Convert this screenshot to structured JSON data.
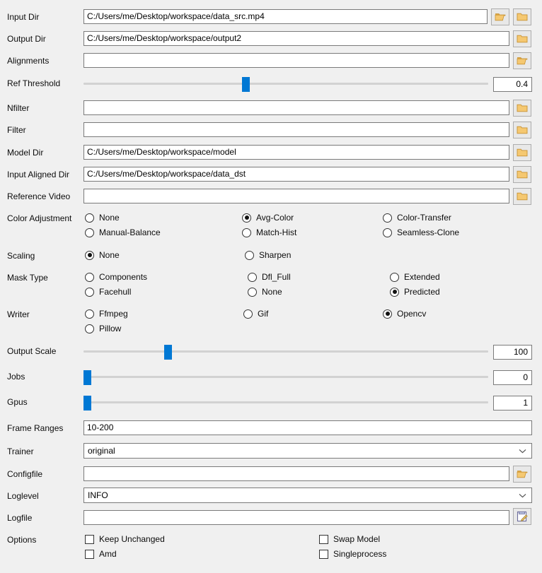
{
  "fields": {
    "input_dir": {
      "label": "Input Dir",
      "value": "C:/Users/me/Desktop/workspace/data_src.mp4"
    },
    "output_dir": {
      "label": "Output Dir",
      "value": "C:/Users/me/Desktop/workspace/output2"
    },
    "alignments": {
      "label": "Alignments",
      "value": ""
    },
    "nfilter": {
      "label": "Nfilter",
      "value": ""
    },
    "filter": {
      "label": "Filter",
      "value": ""
    },
    "model_dir": {
      "label": "Model Dir",
      "value": "C:/Users/me/Desktop/workspace/model"
    },
    "input_aligned": {
      "label": "Input Aligned Dir",
      "value": "C:/Users/me/Desktop/workspace/data_dst"
    },
    "reference_video": {
      "label": "Reference Video",
      "value": ""
    },
    "frame_ranges": {
      "label": "Frame Ranges",
      "value": "10-200"
    },
    "configfile": {
      "label": "Configfile",
      "value": ""
    },
    "logfile": {
      "label": "Logfile",
      "value": ""
    }
  },
  "sliders": {
    "ref_threshold": {
      "label": "Ref Threshold",
      "value": "0.4",
      "percent": 32
    },
    "output_scale": {
      "label": "Output Scale",
      "value": "100",
      "percent": 20
    },
    "jobs": {
      "label": "Jobs",
      "value": "0",
      "percent": 0
    },
    "gpus": {
      "label": "Gpus",
      "value": "1",
      "percent": 0
    }
  },
  "radio_groups": {
    "color_adjustment": {
      "label": "Color Adjustment",
      "options": [
        {
          "label": "None",
          "selected": false
        },
        {
          "label": "Avg-Color",
          "selected": true
        },
        {
          "label": "Color-Transfer",
          "selected": false
        },
        {
          "label": "Manual-Balance",
          "selected": false
        },
        {
          "label": "Match-Hist",
          "selected": false
        },
        {
          "label": "Seamless-Clone",
          "selected": false
        }
      ]
    },
    "scaling": {
      "label": "Scaling",
      "options": [
        {
          "label": "None",
          "selected": true
        },
        {
          "label": "Sharpen",
          "selected": false
        }
      ]
    },
    "mask_type": {
      "label": "Mask Type",
      "options": [
        {
          "label": "Components",
          "selected": false
        },
        {
          "label": "Dfl_Full",
          "selected": false
        },
        {
          "label": "Extended",
          "selected": false
        },
        {
          "label": "Facehull",
          "selected": false
        },
        {
          "label": "None",
          "selected": false
        },
        {
          "label": "Predicted",
          "selected": true
        }
      ]
    },
    "writer": {
      "label": "Writer",
      "options": [
        {
          "label": "Ffmpeg",
          "selected": false
        },
        {
          "label": "Gif",
          "selected": false
        },
        {
          "label": "Opencv",
          "selected": true
        },
        {
          "label": "Pillow",
          "selected": false
        }
      ]
    }
  },
  "combos": {
    "trainer": {
      "label": "Trainer",
      "value": "original"
    },
    "loglevel": {
      "label": "Loglevel",
      "value": "INFO"
    }
  },
  "options": {
    "label": "Options",
    "checkboxes": [
      {
        "label": "Keep Unchanged",
        "checked": false
      },
      {
        "label": "Swap Model",
        "checked": false
      },
      {
        "label": "Amd",
        "checked": false
      },
      {
        "label": "Singleprocess",
        "checked": false
      }
    ]
  },
  "icons": {
    "folder_open": "folder-open-icon",
    "folder_closed": "folder-closed-icon",
    "save_as": "save-as-icon",
    "chevron_down": "chevron-down-icon"
  },
  "colors": {
    "background": "#f0f0f0",
    "slider_handle": "#0078d4",
    "field_border": "#7a7a7a",
    "folder_fill": "#f5c871"
  }
}
